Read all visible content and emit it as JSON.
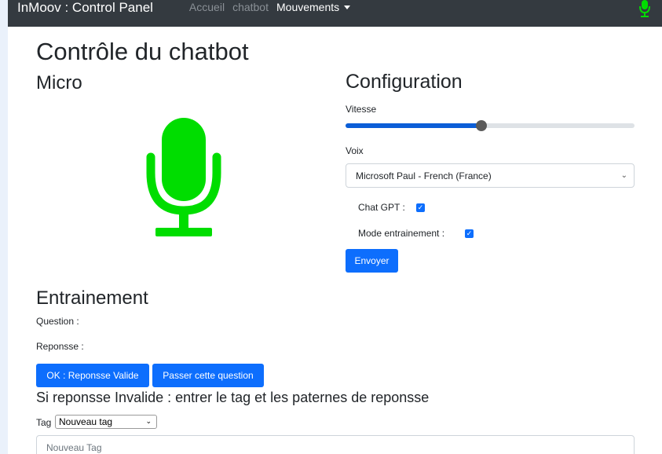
{
  "navbar": {
    "brand": "InMoov : Control Panel",
    "links": [
      "Accueil",
      "chatbot"
    ],
    "dropdown": "Mouvements"
  },
  "page_title": "Contrôle du chatbot",
  "micro": {
    "heading": "Micro",
    "icon": "microphone-icon",
    "color": "#00dd00"
  },
  "config": {
    "heading": "Configuration",
    "speed_label": "Vitesse",
    "speed_value": 0.47,
    "voice_label": "Voix",
    "voice_selected": "Microsoft Paul - French (France)",
    "chatgpt_label": "Chat GPT :",
    "chatgpt_checked": true,
    "training_mode_label": "Mode entrainement :",
    "training_mode_checked": true,
    "send_button": "Envoyer"
  },
  "training": {
    "heading": "Entrainement",
    "question_label": "Question :",
    "answer_label": "Reponsse :",
    "ok_button": "OK : Reponsse Valide",
    "skip_button": "Passer cette question",
    "invalid_heading": "Si reponsse Invalide : entrer le tag et les paternes de reponsse",
    "tag_label": "Tag",
    "tag_selected": "Nouveau tag",
    "new_tag_placeholder": "Nouveau Tag"
  },
  "colors": {
    "accent": "#0d6efd",
    "navbar": "#343a40",
    "mic": "#00dd00"
  }
}
